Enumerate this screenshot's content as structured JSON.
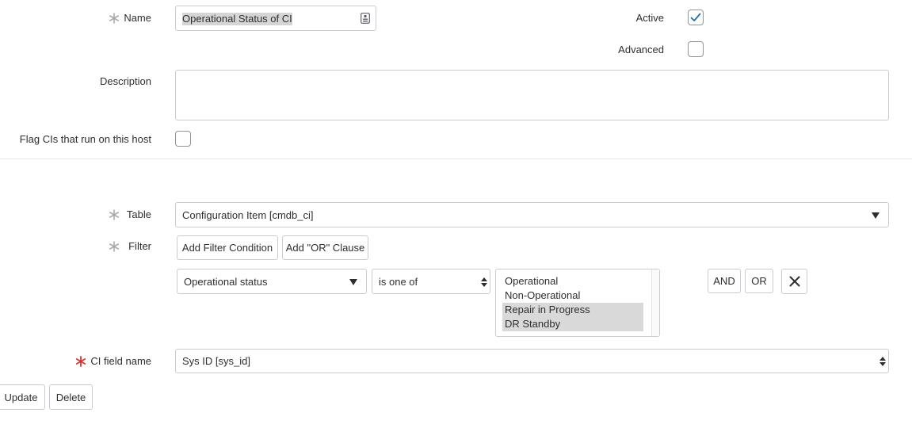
{
  "form": {
    "name": {
      "label": "Name",
      "value": "Operational Status of CI"
    },
    "active": {
      "label": "Active",
      "checked": true
    },
    "advanced": {
      "label": "Advanced",
      "checked": false
    },
    "description": {
      "label": "Description",
      "value": ""
    },
    "flag_cis": {
      "label": "Flag CIs that run on this host",
      "checked": false
    },
    "table": {
      "label": "Table",
      "value": "Configuration Item [cmdb_ci]"
    },
    "filter": {
      "label": "Filter",
      "add_condition_label": "Add Filter Condition",
      "add_or_label": "Add \"OR\" Clause",
      "field": "Operational status",
      "operator": "is one of",
      "options": [
        {
          "label": "Operational",
          "selected": false
        },
        {
          "label": "Non-Operational",
          "selected": false
        },
        {
          "label": "Repair in Progress",
          "selected": true
        },
        {
          "label": "DR Standby",
          "selected": true
        }
      ],
      "and_label": "AND",
      "or_label": "OR"
    },
    "ci_field_name": {
      "label": "CI field name",
      "value": "Sys ID [sys_id]"
    }
  },
  "actions": {
    "update_label": "Update",
    "delete_label": "Delete"
  },
  "colors": {
    "accent": "#1f8476",
    "required_mandatory": "#e0312f",
    "required_optional": "#8f9499",
    "selection": "#d9d9d9"
  }
}
